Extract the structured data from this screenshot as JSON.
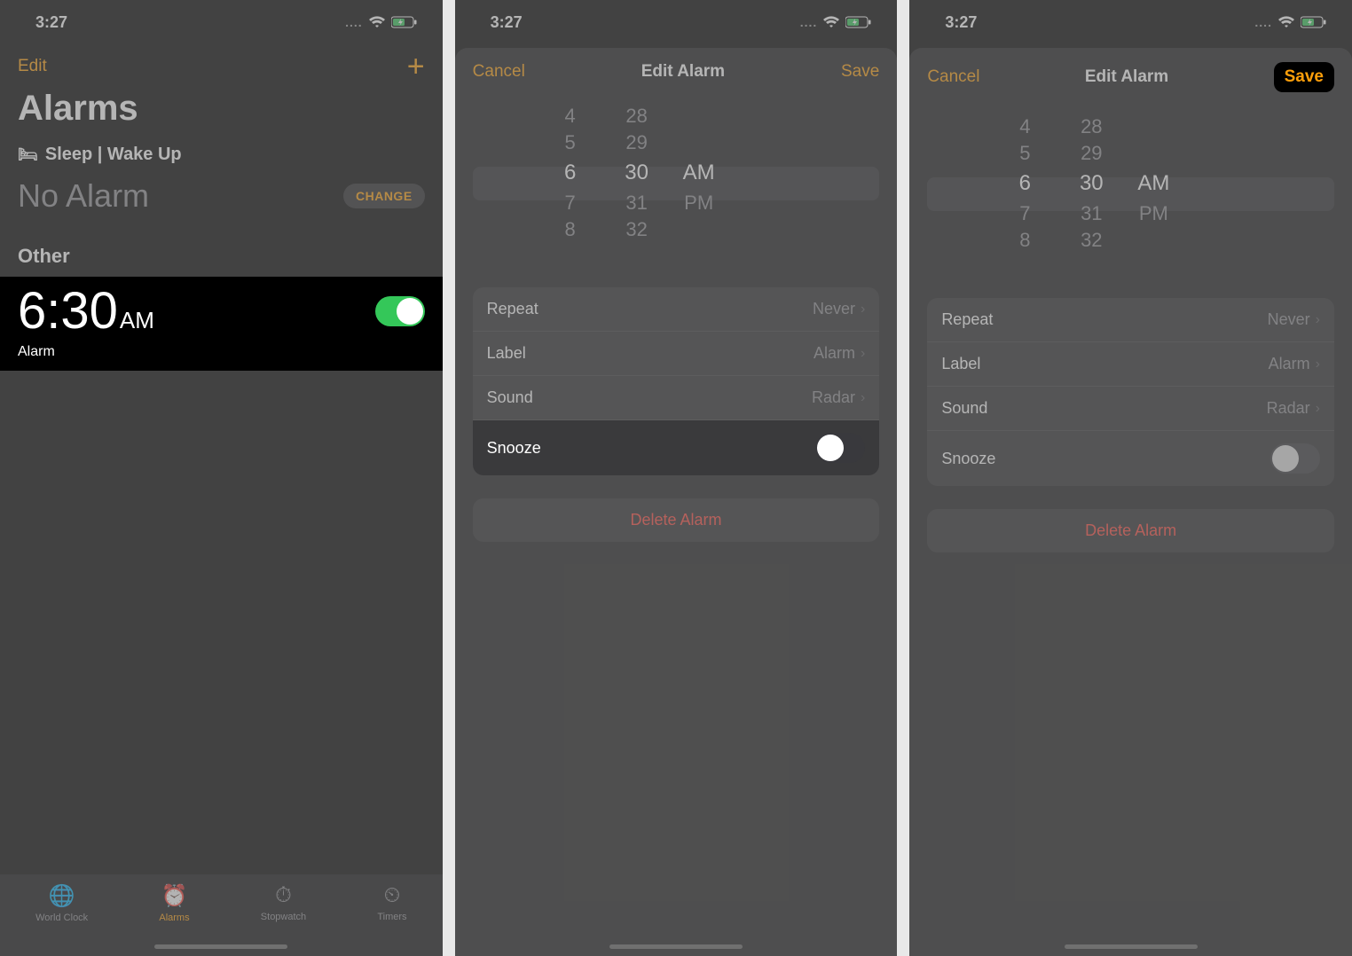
{
  "status": {
    "time": "3:27"
  },
  "screen1": {
    "edit": "Edit",
    "title": "Alarms",
    "sleep_section": "Sleep | Wake Up",
    "no_alarm": "No Alarm",
    "change": "CHANGE",
    "other": "Other",
    "alarm": {
      "time": "6:30",
      "ampm": "AM",
      "label": "Alarm"
    },
    "tabs": {
      "world_clock": "World Clock",
      "alarms": "Alarms",
      "stopwatch": "Stopwatch",
      "timers": "Timers"
    }
  },
  "sheet": {
    "cancel": "Cancel",
    "title": "Edit Alarm",
    "save": "Save",
    "picker": {
      "hours": [
        "4",
        "5",
        "6",
        "7",
        "8"
      ],
      "mins": [
        "28",
        "29",
        "30",
        "31",
        "32"
      ],
      "am": "AM",
      "pm": "PM"
    },
    "rows": {
      "repeat": "Repeat",
      "repeat_val": "Never",
      "label": "Label",
      "label_val": "Alarm",
      "sound": "Sound",
      "sound_val": "Radar",
      "snooze": "Snooze"
    },
    "delete": "Delete Alarm"
  }
}
